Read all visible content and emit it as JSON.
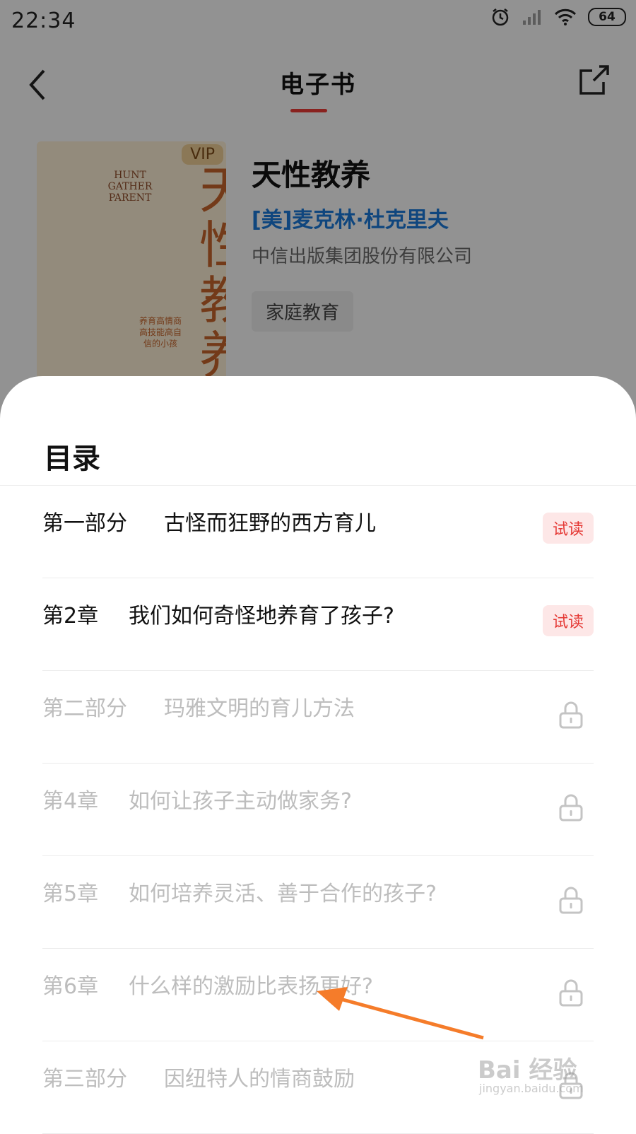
{
  "status_bar": {
    "time": "22:34",
    "battery": "64"
  },
  "header": {
    "title": "电子书"
  },
  "book": {
    "title": "天性教养",
    "author": "[美]麦克林·杜克里夫",
    "publisher": "中信出版集团股份有限公司",
    "tag": "家庭教育",
    "cover": {
      "vip": "VIP",
      "english_title": "HUNT GATHER PARENT",
      "big_title": "天性教养",
      "subtitle": "养育高情商高技能高自信的小孩"
    }
  },
  "toc": {
    "title": "目录",
    "items": [
      {
        "num": "第一部分",
        "name": "古怪而狂野的西方育儿",
        "state": "trial",
        "badge": "试读"
      },
      {
        "num": "第2章",
        "name": "我们如何奇怪地养育了孩子?",
        "state": "trial",
        "badge": "试读"
      },
      {
        "num": "第二部分",
        "name": "玛雅文明的育儿方法",
        "state": "locked",
        "badge": ""
      },
      {
        "num": "第4章",
        "name": "如何让孩子主动做家务?",
        "state": "locked",
        "badge": ""
      },
      {
        "num": "第5章",
        "name": "如何培养灵活、善于合作的孩子?",
        "state": "locked",
        "badge": ""
      },
      {
        "num": "第6章",
        "name": "什么样的激励比表扬更好?",
        "state": "locked",
        "badge": ""
      },
      {
        "num": "第三部分",
        "name": "因纽特人的情商鼓励",
        "state": "locked",
        "badge": ""
      }
    ]
  },
  "watermark": {
    "line1": "Bai 经验",
    "line2": "jingyan.baidu.com"
  },
  "colors": {
    "accent": "#e53935",
    "author": "#1976d2",
    "locked_text": "#bdbdbd"
  }
}
